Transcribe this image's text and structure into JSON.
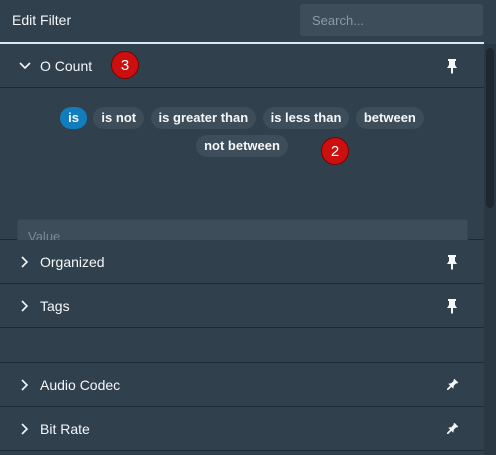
{
  "header": {
    "title": "Edit Filter",
    "search_placeholder": "Search..."
  },
  "expanded_section": {
    "label": "O Count",
    "modifiers": [
      "is",
      "is not",
      "is greater than",
      "is less than",
      "between",
      "not between"
    ],
    "active_modifier": "is",
    "value_placeholder": "Value"
  },
  "sections": [
    {
      "label": "Organized",
      "pinned": true
    },
    {
      "label": "Tags",
      "pinned": true
    },
    {
      "label": "Audio Codec",
      "pinned": false
    },
    {
      "label": "Bit Rate",
      "pinned": false
    }
  ],
  "markers": {
    "m1": "3",
    "m2": "2"
  },
  "colors": {
    "background": "#30404d",
    "accent": "#137cbd",
    "marker": "#cc1010"
  }
}
